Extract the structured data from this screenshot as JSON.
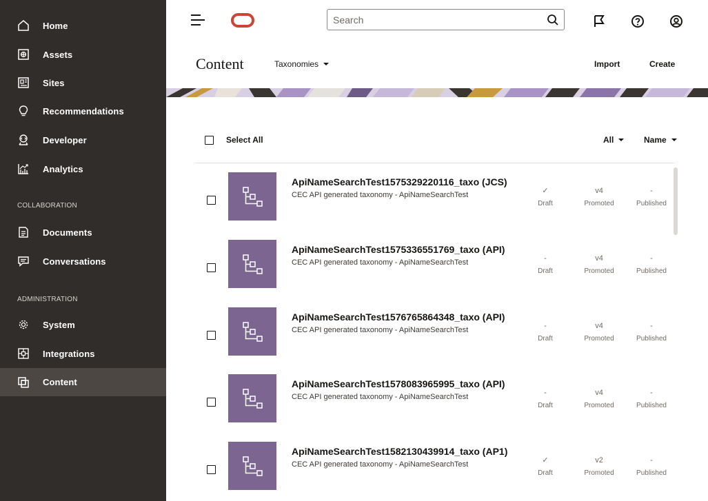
{
  "sidebar": {
    "items": [
      {
        "label": "Home",
        "icon": "home-icon"
      },
      {
        "label": "Assets",
        "icon": "assets-icon"
      },
      {
        "label": "Sites",
        "icon": "sites-icon"
      },
      {
        "label": "Recommendations",
        "icon": "lightbulb-icon"
      },
      {
        "label": "Developer",
        "icon": "developer-icon"
      },
      {
        "label": "Analytics",
        "icon": "analytics-icon"
      },
      {
        "label": "Documents",
        "icon": "documents-icon"
      },
      {
        "label": "Conversations",
        "icon": "conversations-icon"
      },
      {
        "label": "System",
        "icon": "gear-icon"
      },
      {
        "label": "Integrations",
        "icon": "integrations-icon"
      },
      {
        "label": "Content",
        "icon": "content-icon"
      }
    ],
    "sections": {
      "collaboration": "COLLABORATION",
      "administration": "ADMINISTRATION"
    },
    "active": "Content"
  },
  "header": {
    "search_placeholder": "Search",
    "icons": [
      "menu-icon",
      "oracle-logo",
      "search-icon",
      "flag-icon",
      "help-icon",
      "user-icon"
    ]
  },
  "page": {
    "title": "Content",
    "taxonomies_label": "Taxonomies",
    "import_label": "Import",
    "create_label": "Create"
  },
  "list": {
    "select_all": "Select All",
    "filter_label": "All",
    "sort_label": "Name",
    "rows": [
      {
        "title": "ApiNameSearchTest1575329220116_taxo (JCS)",
        "description": "CEC API generated taxonomy - ApiNameSearchTest",
        "draft": "✓",
        "draft_label": "Draft",
        "promoted": "v4",
        "promoted_label": "Promoted",
        "published": "-",
        "published_label": "Published"
      },
      {
        "title": "ApiNameSearchTest1575336551769_taxo (API)",
        "description": "CEC API generated taxonomy - ApiNameSearchTest",
        "draft": "-",
        "draft_label": "Draft",
        "promoted": "v4",
        "promoted_label": "Promoted",
        "published": "-",
        "published_label": "Published"
      },
      {
        "title": "ApiNameSearchTest1576765864348_taxo (API)",
        "description": "CEC API generated taxonomy - ApiNameSearchTest",
        "draft": "-",
        "draft_label": "Draft",
        "promoted": "v4",
        "promoted_label": "Promoted",
        "published": "-",
        "published_label": "Published"
      },
      {
        "title": "ApiNameSearchTest1578083965995_taxo (API)",
        "description": "CEC API generated taxonomy - ApiNameSearchTest",
        "draft": "-",
        "draft_label": "Draft",
        "promoted": "v4",
        "promoted_label": "Promoted",
        "published": "-",
        "published_label": "Published"
      },
      {
        "title": "ApiNameSearchTest1582130439914_taxo (AP1)",
        "description": "CEC API generated taxonomy - ApiNameSearchTest",
        "draft": "✓",
        "draft_label": "Draft",
        "promoted": "v2",
        "promoted_label": "Promoted",
        "published": "-",
        "published_label": "Published"
      }
    ]
  },
  "colors": {
    "sidebar_bg": "#312d2a",
    "sidebar_active": "#4c4743",
    "oracle_red": "#c74634",
    "thumb_purple": "#7d6592"
  }
}
